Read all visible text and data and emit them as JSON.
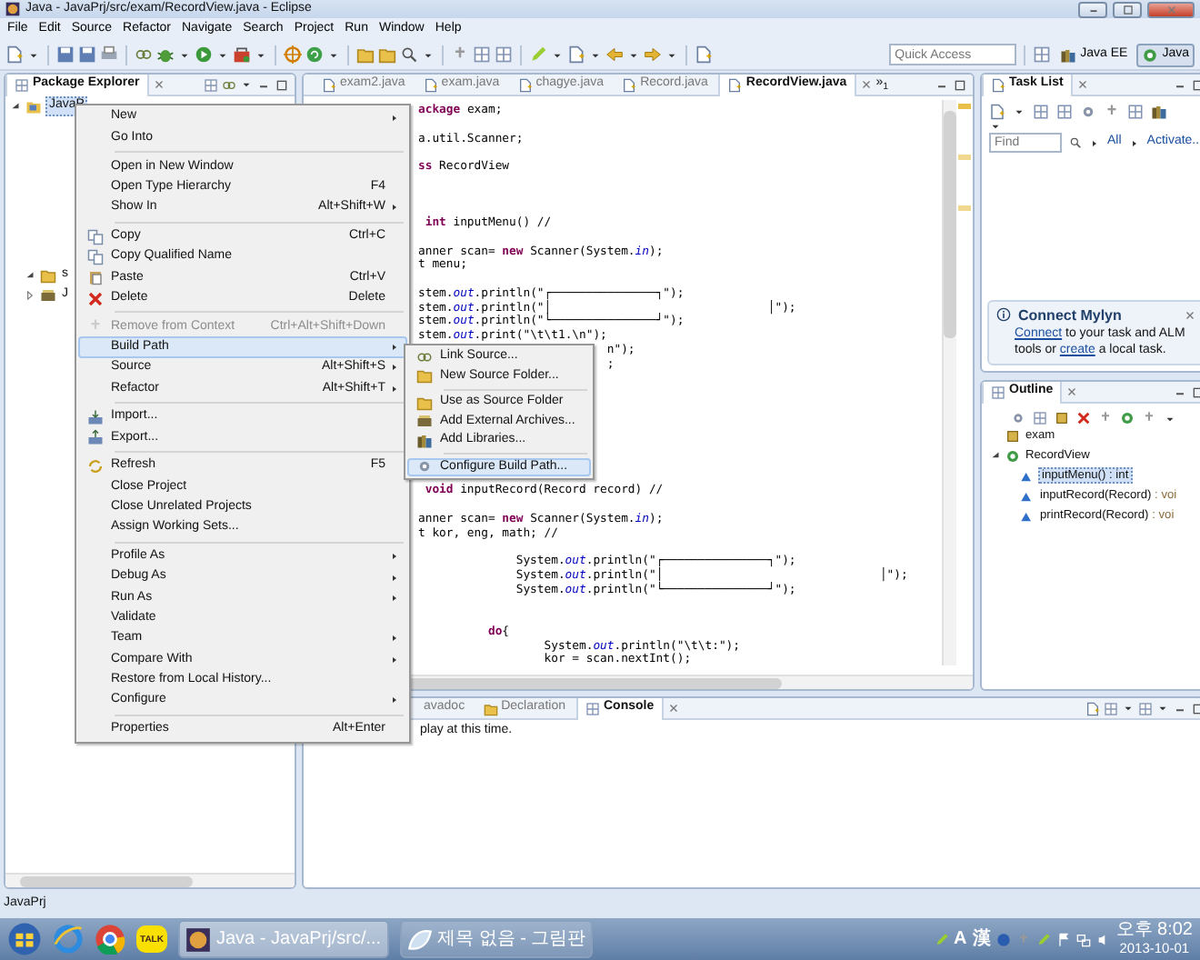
{
  "window": {
    "title": "Java - JavaPrj/src/exam/RecordView.java - Eclipse"
  },
  "menu_bar": [
    "File",
    "Edit",
    "Source",
    "Refactor",
    "Navigate",
    "Search",
    "Project",
    "Run",
    "Window",
    "Help"
  ],
  "toolbar": {
    "quick_access": {
      "placeholder": "Quick Access"
    },
    "perspectives": [
      {
        "label": "Java EE",
        "selected": false
      },
      {
        "label": "Java",
        "selected": true
      }
    ]
  },
  "package_explorer": {
    "title": "Package Explorer",
    "tree": [
      {
        "label": "JavaP",
        "selected": true,
        "expanded": true,
        "children": [
          {
            "label": "s",
            "selected": false,
            "expanded": true
          },
          {
            "label": "J",
            "selected": false,
            "expanded": false
          }
        ]
      }
    ]
  },
  "editor": {
    "tabs": [
      {
        "label": "exam2.java",
        "selected": false
      },
      {
        "label": "exam.java",
        "selected": false
      },
      {
        "label": "chagye.java",
        "selected": false
      },
      {
        "label": "Record.java",
        "selected": false
      },
      {
        "label": "RecordView.java",
        "selected": true
      }
    ],
    "overflow": "»$_{1}$",
    "code_lines": [
      {
        "kind": "code",
        "text": "**ackage** exam;"
      },
      {
        "kind": "blank"
      },
      {
        "kind": "code",
        "text": "a.util.Scanner;"
      },
      {
        "kind": "blank"
      },
      {
        "kind": "code",
        "text": "**ss** RecordView"
      },
      {
        "kind": "blank"
      },
      {
        "kind": "blank"
      },
      {
        "kind": "blank"
      },
      {
        "kind": "code",
        "text": " **int** inputMenu() //"
      },
      {
        "kind": "blank"
      },
      {
        "kind": "code",
        "text": "anner scan= **new** Scanner(System.*in*);"
      },
      {
        "kind": "code",
        "text": "t menu;"
      },
      {
        "kind": "blank"
      },
      {
        "kind": "code",
        "text": "stem.*out*.println(\"┌───────────────┐\");"
      },
      {
        "kind": "code",
        "text": "stem.*out*.println(\"│                               │\");"
      },
      {
        "kind": "code",
        "text": "stem.*out*.println(\"└───────────────┘\");"
      },
      {
        "kind": "code",
        "text": "stem.*out*.print(\"\\t\\t1.\\n\");"
      },
      {
        "kind": "code",
        "text": "                           n\");"
      },
      {
        "kind": "code",
        "text": "                           ;"
      },
      {
        "kind": "blank"
      },
      {
        "kind": "blank"
      },
      {
        "kind": "blank"
      },
      {
        "kind": "blank"
      },
      {
        "kind": "blank"
      },
      {
        "kind": "blank"
      },
      {
        "kind": "blank"
      },
      {
        "kind": "blank"
      },
      {
        "kind": "code",
        "text": " **void** inputRecord(Record record) //"
      },
      {
        "kind": "blank"
      },
      {
        "kind": "code",
        "text": "anner scan= **new** Scanner(System.*in*);"
      },
      {
        "kind": "code",
        "text": "t kor, eng, math; //"
      },
      {
        "kind": "blank"
      },
      {
        "kind": "code",
        "text": "              System.*out*.println(\"┌───────────────┐\");"
      },
      {
        "kind": "code",
        "text": "              System.*out*.println(\"│                               │\");"
      },
      {
        "kind": "code",
        "text": "              System.*out*.println(\"└───────────────┘\");"
      },
      {
        "kind": "blank"
      },
      {
        "kind": "blank"
      },
      {
        "kind": "code",
        "text": "          **do**{"
      },
      {
        "kind": "code",
        "text": "                  System.*out*.println(\"\\t\\t:\");"
      },
      {
        "kind": "code",
        "text": "                  kor = scan.nextInt();"
      }
    ]
  },
  "task_list": {
    "title": "Task List",
    "find": {
      "placeholder": "Find"
    },
    "filters": [
      "All",
      "Activate..."
    ],
    "mylyn": {
      "title": "Connect Mylyn",
      "message": [
        {
          "text": "Connect",
          "link": true
        },
        {
          "text": " to your task and ALM tools or ",
          "link": false
        },
        {
          "text": "create",
          "link": true
        },
        {
          "text": " a local task.",
          "link": false
        }
      ]
    }
  },
  "outline": {
    "title": "Outline",
    "items": [
      {
        "kind": "package",
        "label": "exam",
        "selected": false
      },
      {
        "kind": "class",
        "label": "RecordView",
        "selected": false,
        "expanded": true,
        "children": [
          {
            "kind": "method",
            "label": "inputMenu()",
            "type": " : int",
            "selected": true
          },
          {
            "kind": "method",
            "label": "inputRecord(Record)",
            "type": " : voi",
            "selected": false
          },
          {
            "kind": "method",
            "label": "printRecord(Record)",
            "type": " : voi",
            "selected": false
          }
        ]
      }
    ]
  },
  "console": {
    "tabs": [
      {
        "label": "avadoc",
        "selected": false
      },
      {
        "label": "Declaration",
        "selected": false
      },
      {
        "label": "Console",
        "selected": true
      }
    ],
    "message": "play at this time."
  },
  "context_menu": {
    "items": [
      {
        "kind": "item",
        "label": "New",
        "submenu": true,
        "disabled": false,
        "selected": false
      },
      {
        "kind": "item",
        "label": "Go Into",
        "submenu": false,
        "disabled": false,
        "selected": false
      },
      {
        "kind": "separator"
      },
      {
        "kind": "item",
        "label": "Open in New Window",
        "submenu": false,
        "disabled": false,
        "selected": false
      },
      {
        "kind": "item",
        "label": "Open Type Hierarchy",
        "shortcut": "F4",
        "submenu": false,
        "disabled": false,
        "selected": false
      },
      {
        "kind": "item",
        "label": "Show In",
        "shortcut": "Alt+Shift+W",
        "submenu": true,
        "disabled": false,
        "selected": false
      },
      {
        "kind": "separator"
      },
      {
        "kind": "item",
        "label": "Copy",
        "shortcut": "Ctrl+C",
        "submenu": false,
        "disabled": false,
        "selected": false
      },
      {
        "kind": "item",
        "label": "Copy Qualified Name",
        "submenu": false,
        "disabled": false,
        "selected": false
      },
      {
        "kind": "item",
        "label": "Paste",
        "shortcut": "Ctrl+V",
        "submenu": false,
        "disabled": false,
        "selected": false
      },
      {
        "kind": "item",
        "label": "Delete",
        "shortcut": "Delete",
        "submenu": false,
        "disabled": false,
        "selected": false
      },
      {
        "kind": "separator"
      },
      {
        "kind": "item",
        "label": "Remove from Context",
        "shortcut": "Ctrl+Alt+Shift+Down",
        "submenu": false,
        "disabled": true,
        "selected": false
      },
      {
        "kind": "item",
        "label": "Build Path",
        "submenu": true,
        "disabled": false,
        "selected": true
      },
      {
        "kind": "item",
        "label": "Source",
        "shortcut": "Alt+Shift+S",
        "submenu": true,
        "disabled": false,
        "selected": false
      },
      {
        "kind": "item",
        "label": "Refactor",
        "shortcut": "Alt+Shift+T",
        "submenu": true,
        "disabled": false,
        "selected": false
      },
      {
        "kind": "separator"
      },
      {
        "kind": "item",
        "label": "Import...",
        "submenu": false,
        "disabled": false,
        "selected": false
      },
      {
        "kind": "item",
        "label": "Export...",
        "submenu": false,
        "disabled": false,
        "selected": false
      },
      {
        "kind": "separator"
      },
      {
        "kind": "item",
        "label": "Refresh",
        "shortcut": "F5",
        "submenu": false,
        "disabled": false,
        "selected": false
      },
      {
        "kind": "item",
        "label": "Close Project",
        "submenu": false,
        "disabled": false,
        "selected": false
      },
      {
        "kind": "item",
        "label": "Close Unrelated Projects",
        "submenu": false,
        "disabled": false,
        "selected": false
      },
      {
        "kind": "item",
        "label": "Assign Working Sets...",
        "submenu": false,
        "disabled": false,
        "selected": false
      },
      {
        "kind": "separator"
      },
      {
        "kind": "item",
        "label": "Profile As",
        "submenu": true,
        "disabled": false,
        "selected": false
      },
      {
        "kind": "item",
        "label": "Debug As",
        "submenu": true,
        "disabled": false,
        "selected": false
      },
      {
        "kind": "item",
        "label": "Run As",
        "submenu": true,
        "disabled": false,
        "selected": false
      },
      {
        "kind": "item",
        "label": "Validate",
        "submenu": false,
        "disabled": false,
        "selected": false
      },
      {
        "kind": "item",
        "label": "Team",
        "submenu": true,
        "disabled": false,
        "selected": false
      },
      {
        "kind": "item",
        "label": "Compare With",
        "submenu": true,
        "disabled": false,
        "selected": false
      },
      {
        "kind": "item",
        "label": "Restore from Local History...",
        "submenu": false,
        "disabled": false,
        "selected": false
      },
      {
        "kind": "item",
        "label": "Configure",
        "submenu": true,
        "disabled": false,
        "selected": false
      },
      {
        "kind": "separator"
      },
      {
        "kind": "item",
        "label": "Properties",
        "shortcut": "Alt+Enter",
        "submenu": false,
        "disabled": false,
        "selected": false
      }
    ]
  },
  "build_path_menu": {
    "items": [
      {
        "kind": "item",
        "label": "Link Source...",
        "selected": false
      },
      {
        "kind": "item",
        "label": "New Source Folder...",
        "selected": false
      },
      {
        "kind": "separator"
      },
      {
        "kind": "item",
        "label": "Use as Source Folder",
        "selected": false
      },
      {
        "kind": "item",
        "label": "Add External Archives...",
        "selected": false
      },
      {
        "kind": "item",
        "label": "Add Libraries...",
        "selected": false
      },
      {
        "kind": "separator"
      },
      {
        "kind": "item",
        "label": "Configure Build Path...",
        "selected": true
      }
    ]
  },
  "status_bar": {
    "text": "JavaPrj"
  },
  "taskbar": {
    "talk_icon_text": "TALK",
    "tasks": [
      {
        "label": "Java - JavaPrj/src/...",
        "selected": true
      },
      {
        "label": "제목 없음 - 그림판",
        "selected": false
      }
    ],
    "ime": [
      "A",
      "漢"
    ],
    "time": "오후 8:02",
    "date": "2013-10-01"
  }
}
